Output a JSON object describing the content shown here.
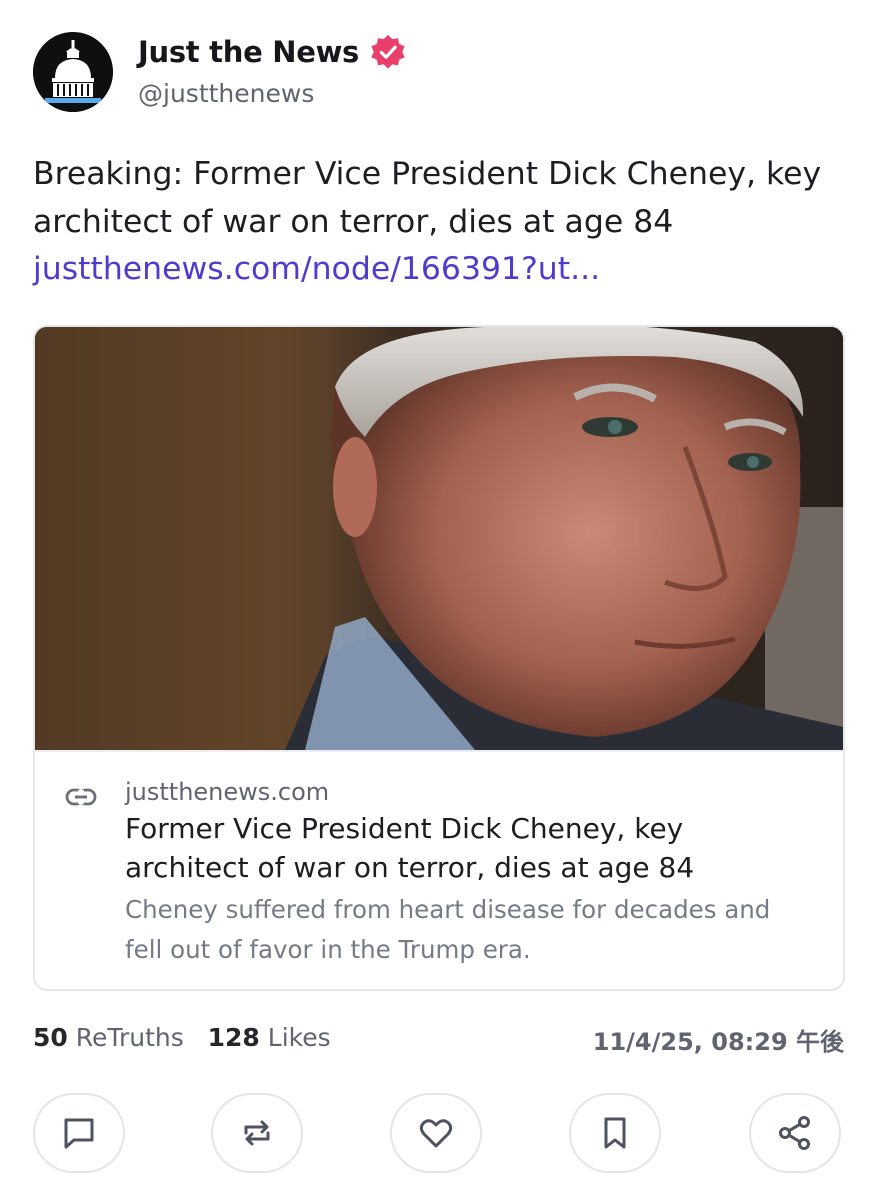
{
  "account": {
    "display_name": "Just the News",
    "handle": "@justthenews",
    "verified": true,
    "verified_color": "#ea3e6b"
  },
  "post": {
    "text": "Breaking: Former Vice President Dick Cheney, key architect of war on terror, dies at age 84",
    "link_text": "justthenews.com/node/166391?ut..."
  },
  "card": {
    "image_subject": "Close-up portrait photo of Dick Cheney",
    "link_icon": "link-icon",
    "domain": "justthenews.com",
    "title": "Former Vice President Dick Cheney, key architect of war on terror, dies at age 84",
    "description": "Cheney suffered from heart disease for decades and fell out of favor in the Trump era."
  },
  "stats": {
    "retruths_count": "50",
    "retruths_label": "ReTruths",
    "likes_count": "128",
    "likes_label": "Likes",
    "timestamp": "11/4/25, 08:29 午後"
  },
  "actions": [
    {
      "icon": "reply-icon"
    },
    {
      "icon": "retruth-icon"
    },
    {
      "icon": "like-icon"
    },
    {
      "icon": "bookmark-icon"
    },
    {
      "icon": "share-icon"
    }
  ],
  "colors": {
    "link": "#4f3ccf",
    "secondary_text": "#5f6470",
    "border": "#e6e7eb"
  }
}
